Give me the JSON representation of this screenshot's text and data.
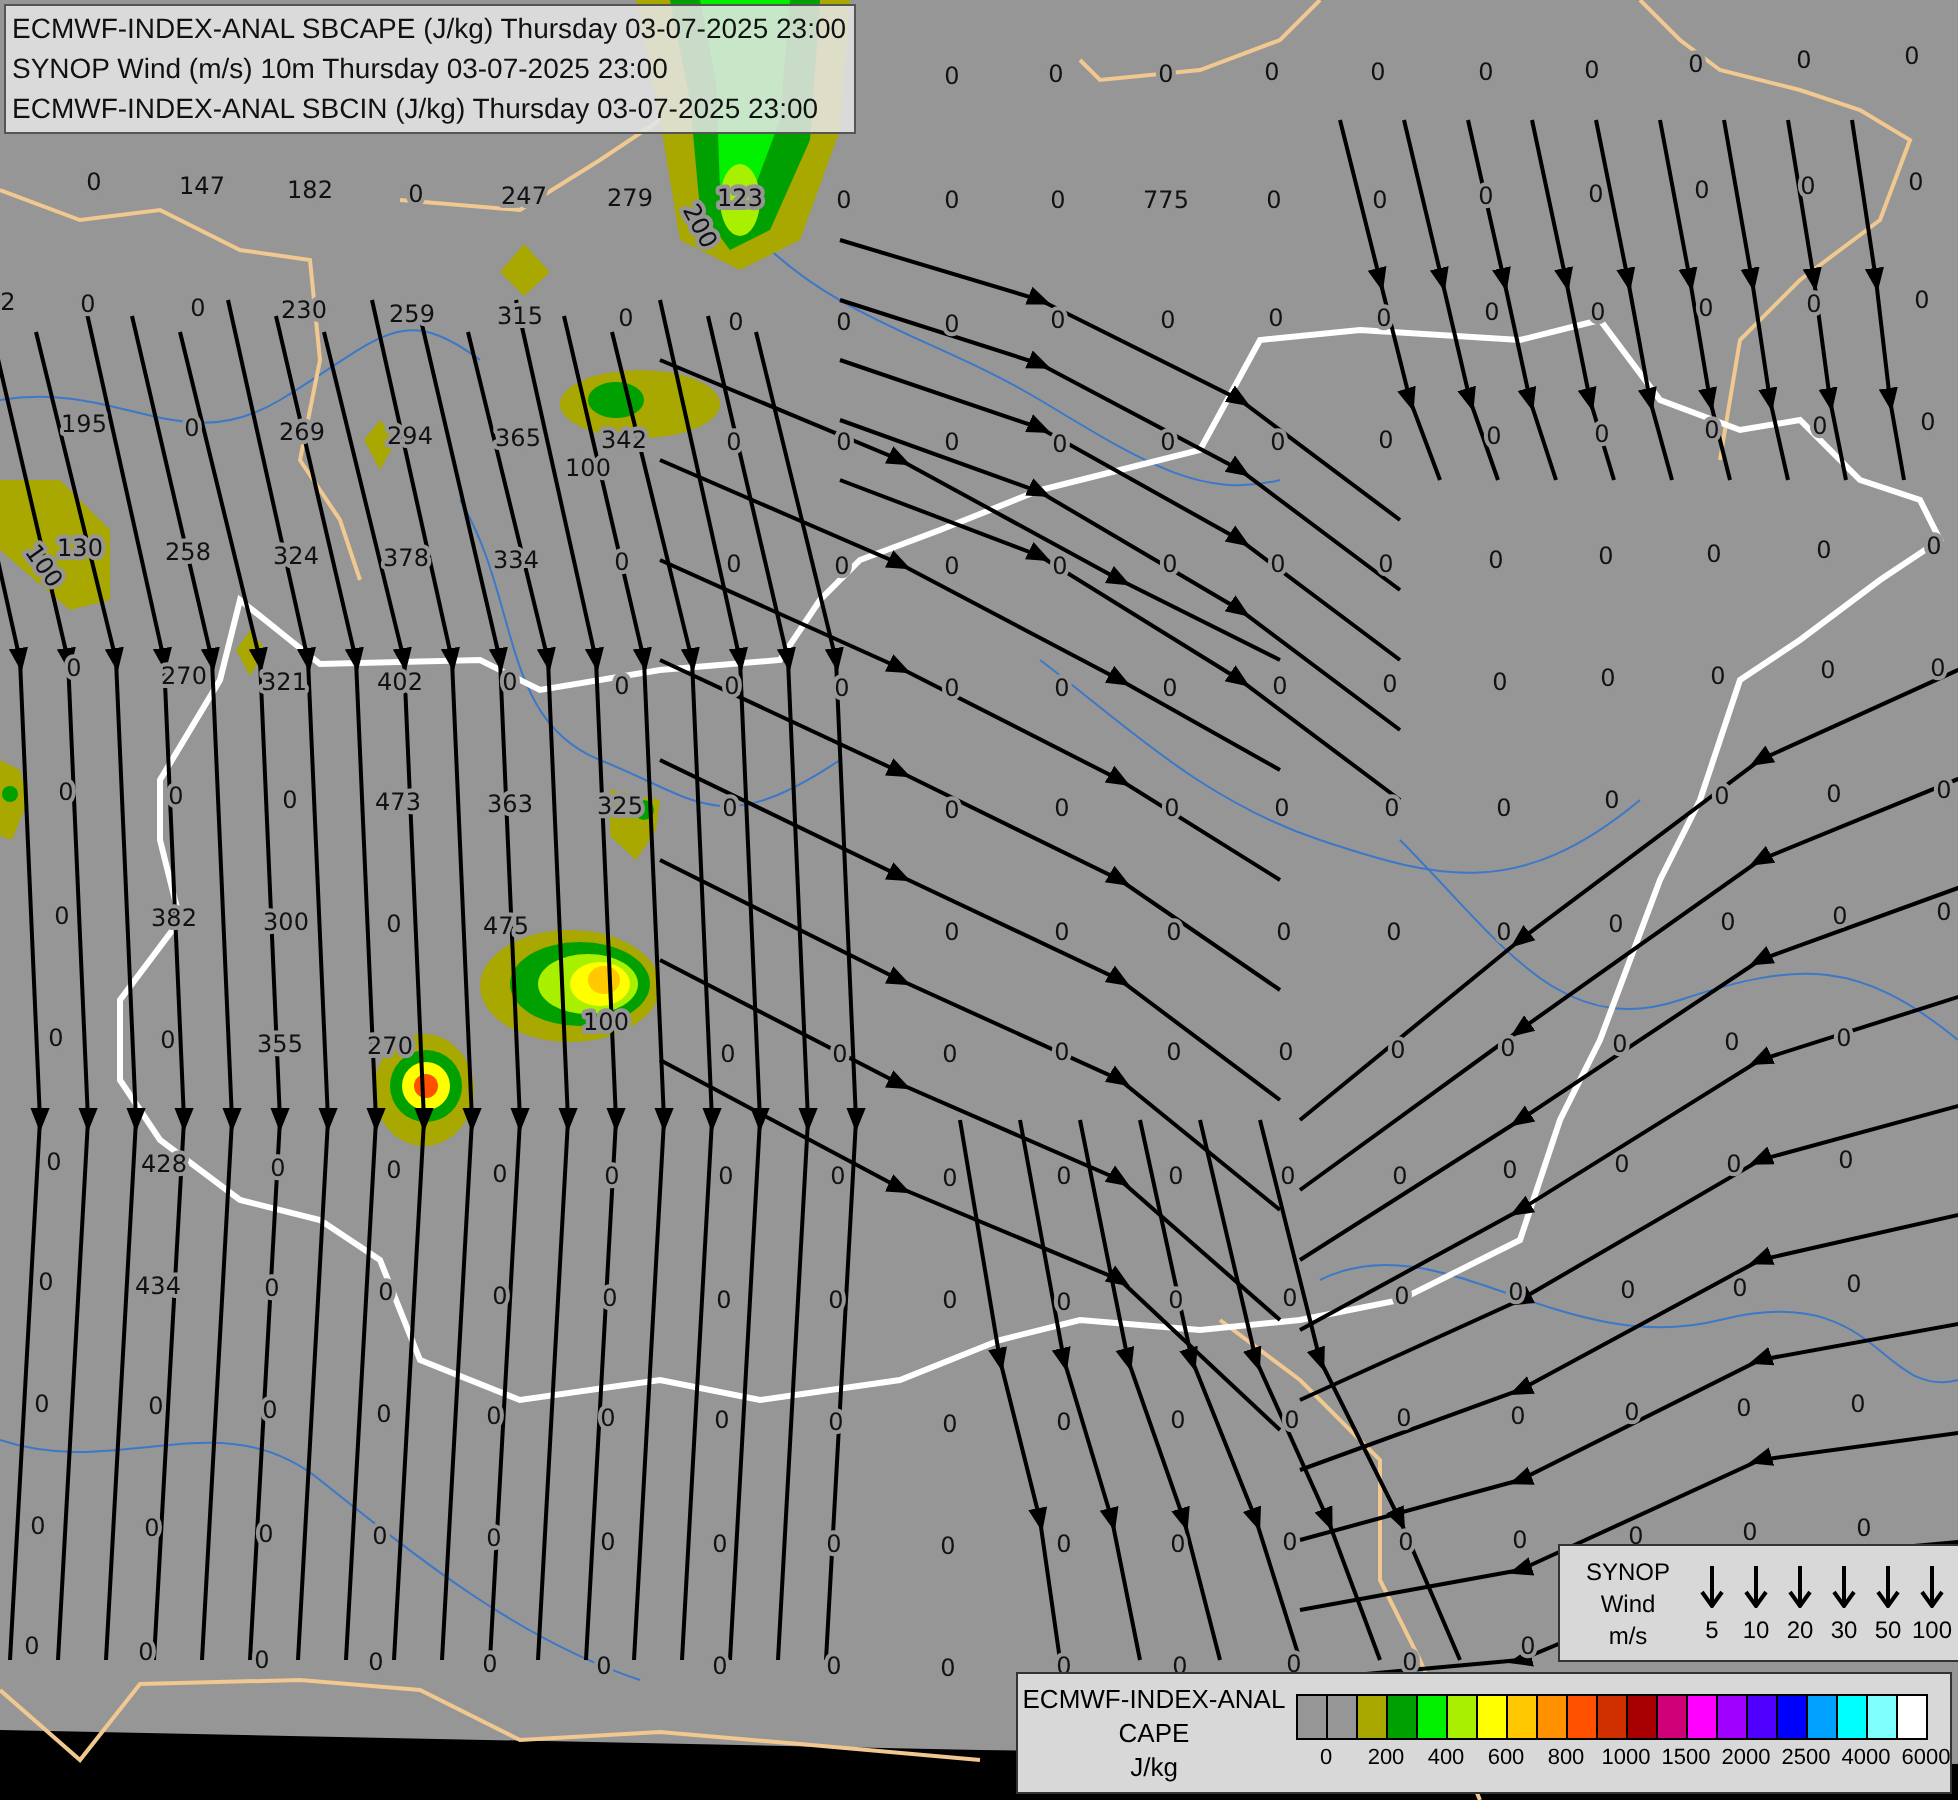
{
  "header": {
    "lines": [
      "ECMWF-INDEX-ANAL SBCAPE (J/kg) Thursday 03-07-2025 23:00",
      "SYNOP Wind (m/s) 10m Thursday 03-07-2025 23:00",
      "ECMWF-INDEX-ANAL SBCIN (J/kg) Thursday 03-07-2025 23:00"
    ]
  },
  "map": {
    "value_label_rows": [
      [
        "0",
        "0",
        "0",
        "0",
        "0",
        "0",
        "0",
        "0",
        "0",
        "0"
      ],
      [
        "0",
        "147",
        "182",
        "0",
        "247",
        "279",
        "123",
        "0",
        "0",
        "0",
        "775",
        "0",
        "0",
        "0",
        "0",
        "0",
        "0",
        "0"
      ],
      [
        "2",
        "0",
        "0",
        "230",
        "259",
        "315",
        "0",
        "0",
        "0",
        "0",
        "0",
        "0",
        "0",
        "0",
        "0",
        "0",
        "0",
        "0",
        "0"
      ],
      [
        "195",
        "0",
        "269",
        "294",
        "365",
        "342",
        "0",
        "0",
        "0",
        "0",
        "0",
        "0",
        "0",
        "0",
        "0",
        "0",
        "0",
        "0"
      ],
      [
        "130",
        "258",
        "324",
        "378",
        "334",
        "0",
        "0",
        "0",
        "0",
        "0",
        "0",
        "0",
        "0",
        "0",
        "0",
        "0",
        "0",
        "0"
      ],
      [
        "0",
        "270",
        "321",
        "402",
        "0",
        "0",
        "0",
        "0",
        "0",
        "0",
        "0",
        "0",
        "0",
        "0",
        "0",
        "0",
        "0",
        "0"
      ],
      [
        "0",
        "0",
        "0",
        "473",
        "363",
        "325",
        "0",
        "0",
        "0",
        "0",
        "0",
        "0",
        "0",
        "0",
        "0",
        "0",
        "0"
      ],
      [
        "0",
        "382",
        "300",
        "0",
        "475",
        "0",
        "0",
        "0",
        "0",
        "0",
        "0",
        "0",
        "0",
        "0",
        "0"
      ],
      [
        "0",
        "0",
        "355",
        "270",
        "0",
        "0",
        "0",
        "0",
        "0",
        "0",
        "0",
        "0",
        "0",
        "0",
        "0"
      ],
      [
        "0",
        "428",
        "0",
        "0",
        "0",
        "0",
        "0",
        "0",
        "0",
        "0",
        "0",
        "0",
        "0",
        "0",
        "0",
        "0",
        "0"
      ],
      [
        "0",
        "434",
        "0",
        "0",
        "0",
        "0",
        "0",
        "0",
        "0",
        "0",
        "0",
        "0",
        "0",
        "0",
        "0",
        "0",
        "0"
      ],
      [
        "0",
        "0",
        "0",
        "0",
        "0",
        "0",
        "0",
        "0",
        "0",
        "0",
        "0",
        "0",
        "0",
        "0",
        "0",
        "0",
        "0"
      ],
      [
        "0",
        "0",
        "0",
        "0",
        "0",
        "0",
        "0",
        "0",
        "0",
        "0",
        "0",
        "0",
        "0",
        "0",
        "0",
        "0",
        "0"
      ],
      [
        "0",
        "0",
        "0",
        "0",
        "0",
        "0",
        "0",
        "0",
        "0",
        "0",
        "0",
        "0",
        "0",
        "0"
      ]
    ],
    "contour_labels": [
      "200",
      "100",
      "100",
      "100"
    ]
  },
  "wind_legend": {
    "title_lines": [
      "SYNOP",
      "Wind",
      "m/s"
    ],
    "speeds": [
      "5",
      "10",
      "20",
      "30",
      "50",
      "100"
    ]
  },
  "cape_legend": {
    "title_lines": [
      "ECMWF-INDEX-ANAL",
      "CAPE",
      "J/kg"
    ],
    "swatches": [
      {
        "color": "#969696"
      },
      {
        "color": "#969696"
      },
      {
        "color": "#a8a800"
      },
      {
        "color": "#00a000"
      },
      {
        "color": "#00f000"
      },
      {
        "color": "#a8f000"
      },
      {
        "color": "#ffff00"
      },
      {
        "color": "#ffc800"
      },
      {
        "color": "#ff9000"
      },
      {
        "color": "#ff5000"
      },
      {
        "color": "#d03000"
      },
      {
        "color": "#a80000"
      },
      {
        "color": "#d00078"
      },
      {
        "color": "#ff00ff"
      },
      {
        "color": "#a000ff"
      },
      {
        "color": "#5000ff"
      },
      {
        "color": "#0000ff"
      },
      {
        "color": "#00a0ff"
      },
      {
        "color": "#00ffff"
      },
      {
        "color": "#80ffff"
      },
      {
        "color": "#ffffff"
      }
    ],
    "ticks": [
      "0",
      "200",
      "400",
      "600",
      "800",
      "1000",
      "1500",
      "2000",
      "2500",
      "4000",
      "6000"
    ]
  }
}
